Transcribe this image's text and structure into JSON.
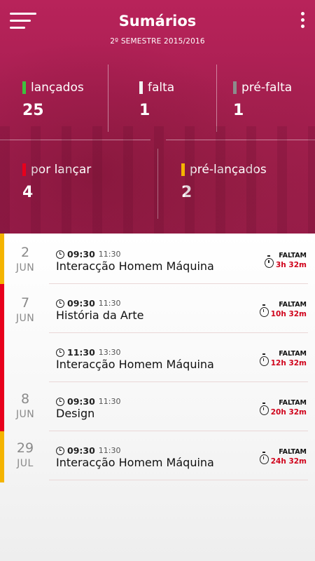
{
  "app": {
    "title": "Sumários",
    "subtitle": "2º SEMESTRE 2015/2016"
  },
  "stats": {
    "lancados": {
      "label": "lançados",
      "value": "25",
      "color": "#3ec13e"
    },
    "falta": {
      "label": "falta",
      "value": "1",
      "color": "#f2f2f2"
    },
    "pre_falta": {
      "label": "pré-falta",
      "value": "1",
      "color": "#8c8c8c"
    },
    "por_lancar": {
      "label": "por lançar",
      "value": "4",
      "color": "#e8001c"
    },
    "pre_lancados": {
      "label": "pré-lançados",
      "value": "2",
      "color": "#f4b400"
    }
  },
  "colors": {
    "header": "#a91f52",
    "bar_yellow": "#f4b400",
    "bar_red": "#e8001c",
    "countdown": "#d0021b"
  },
  "days": [
    {
      "day": "2",
      "month": "JUN"
    },
    {
      "day": "7",
      "month": "JUN"
    },
    {
      "day": "8",
      "month": "JUN"
    },
    {
      "day": "29",
      "month": "JUL"
    }
  ],
  "items": [
    {
      "start": "09:30",
      "end": "11:30",
      "subject": "Interacção Homem Máquina",
      "faltam": "FALTAM",
      "remaining": "3h 32m"
    },
    {
      "start": "09:30",
      "end": "11:30",
      "subject": "História da Arte",
      "faltam": "FALTAM",
      "remaining": "10h 32m"
    },
    {
      "start": "11:30",
      "end": "13:30",
      "subject": "Interacção Homem Máquina",
      "faltam": "FALTAM",
      "remaining": "12h 32m"
    },
    {
      "start": "09:30",
      "end": "11:30",
      "subject": "Design",
      "faltam": "FALTAM",
      "remaining": "20h 32m"
    },
    {
      "start": "09:30",
      "end": "11:30",
      "subject": "Interacção Homem Máquina",
      "faltam": "FALTAM",
      "remaining": "24h 32m"
    }
  ]
}
